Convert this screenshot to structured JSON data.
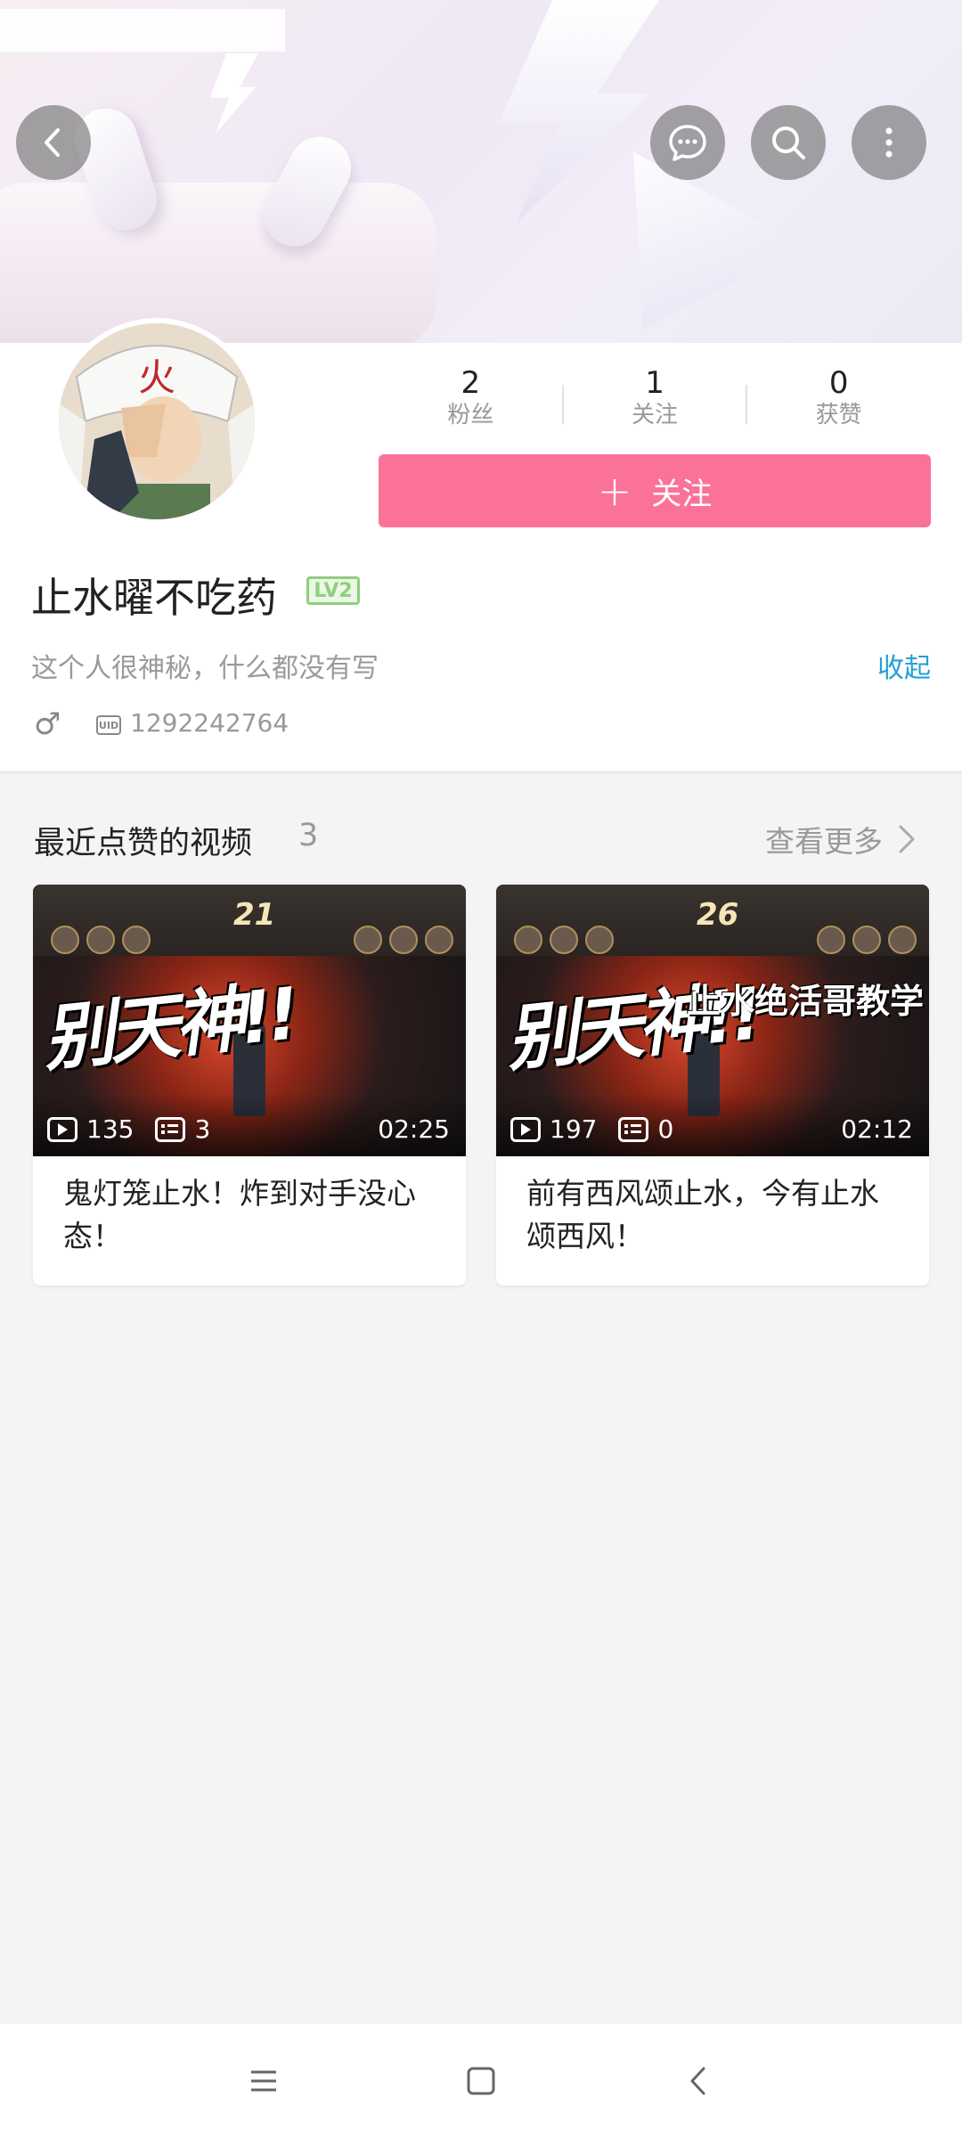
{
  "profile": {
    "stats": [
      {
        "value": "2",
        "label": "粉丝"
      },
      {
        "value": "1",
        "label": "关注"
      },
      {
        "value": "0",
        "label": "获赞"
      }
    ],
    "follow_label": "关注",
    "username": "止水曜不吃药",
    "level_badge": "LV2",
    "bio": "这个人很神秘，什么都没有写",
    "collapse_label": "收起",
    "gender_symbol": "♂",
    "uid_badge": "UID",
    "uid": "1292242764"
  },
  "liked": {
    "title": "最近点赞的视频",
    "count": "3",
    "more_label": "查看更多"
  },
  "videos": [
    {
      "level": "21",
      "cover_text": "别天神!!",
      "cover_subtitle": "",
      "plays": "135",
      "danmaku": "3",
      "duration": "02:25",
      "title": "鬼灯笼止水！炸到对手没心态！"
    },
    {
      "level": "26",
      "cover_text": "别天神!!",
      "cover_subtitle": "止水绝活哥教学",
      "plays": "197",
      "danmaku": "0",
      "duration": "02:12",
      "title": "前有西风颂止水，今有止水颂西风！"
    }
  ],
  "colors": {
    "accent_pink": "#fb7299",
    "link_blue": "#23a0d8",
    "level_green": "#8fcf7f"
  },
  "icons": [
    "back-icon",
    "chat-icon",
    "search-icon",
    "more-icon",
    "plus-icon",
    "chevron-right-icon",
    "play-count-icon",
    "danmaku-icon",
    "menu-icon",
    "home-icon",
    "back-nav-icon"
  ]
}
